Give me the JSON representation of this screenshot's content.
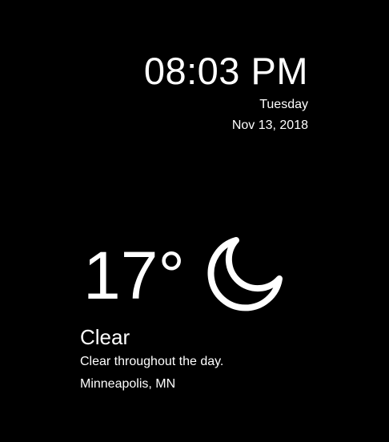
{
  "clock": {
    "time": "08:03 PM",
    "weekday": "Tuesday",
    "date": "Nov 13, 2018"
  },
  "weather": {
    "temperature": "17°",
    "icon": "crescent-moon-icon",
    "condition": "Clear",
    "summary": "Clear throughout the day.",
    "location": "Minneapolis, MN"
  },
  "colors": {
    "background": "#000000",
    "foreground": "#ffffff"
  }
}
